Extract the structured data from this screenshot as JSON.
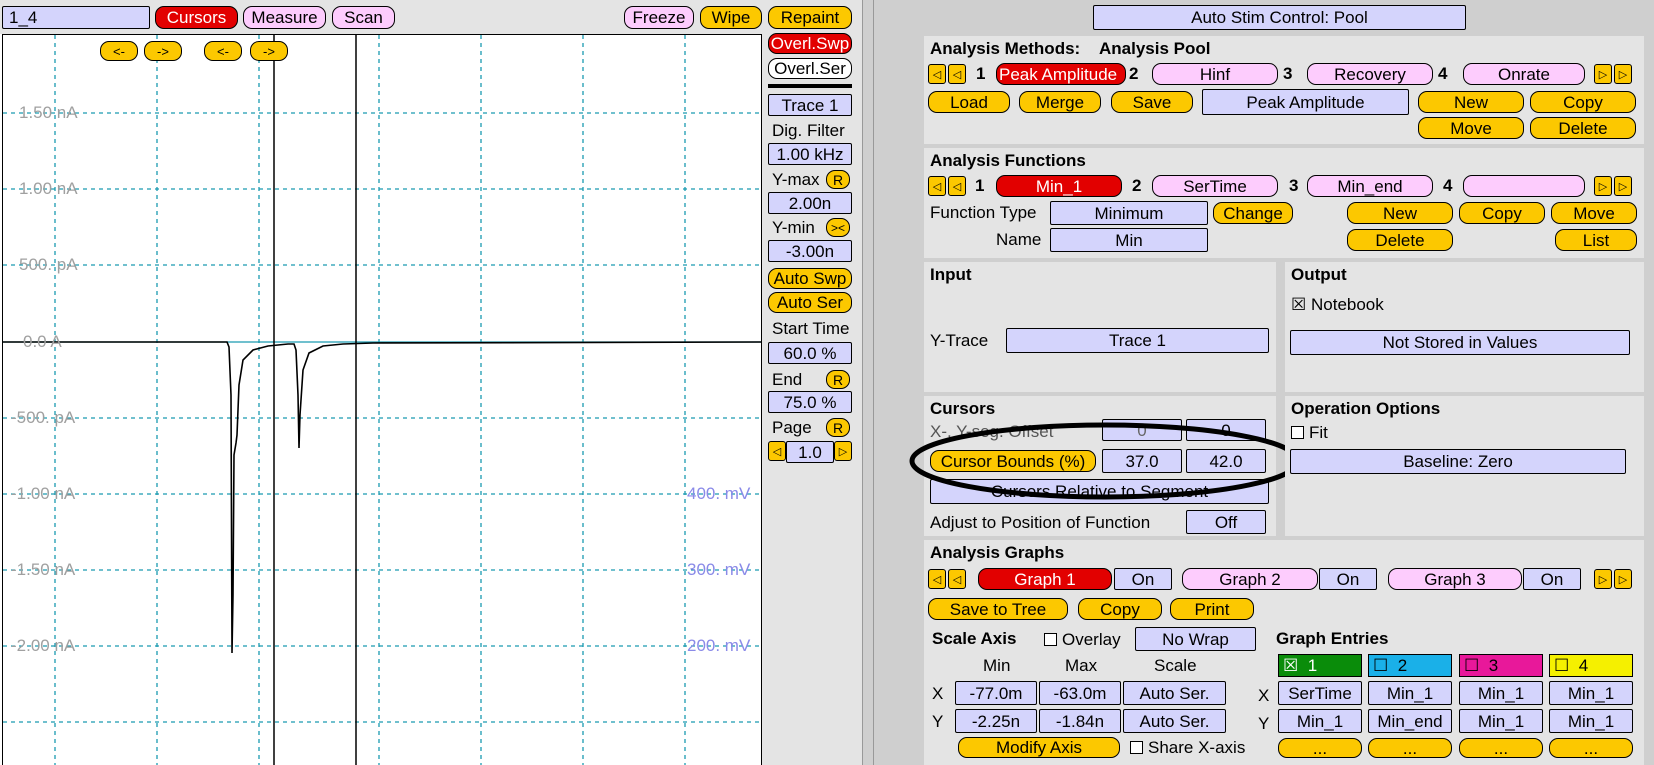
{
  "top": {
    "series_field": "1_4",
    "cursors": "Cursors",
    "measure": "Measure",
    "scan": "Scan",
    "freeze": "Freeze",
    "wipe": "Wipe",
    "repaint": "Repaint"
  },
  "scope": {
    "cursor_nav": [
      "<-",
      "->",
      "<-",
      "->"
    ],
    "y_labels": [
      "1.50 nA",
      "1.00 nA",
      "500. pA",
      "0.0 A",
      "-500. pA",
      "-1.00 nA",
      "-1.50 nA",
      "-2.00 nA"
    ],
    "v_labels": [
      "400. mV",
      "300. mV",
      "200. mV"
    ]
  },
  "sidebar": {
    "overl_swp": "Overl.Swp",
    "overl_ser": "Overl.Ser",
    "trace": "Trace 1",
    "dig_filter_label": "Dig. Filter",
    "dig_filter": "1.00 kHz",
    "ymax_label": "Y-max",
    "ymax": "2.00n",
    "r1": "R",
    "ymin_label": "Y-min",
    "ymin": "-3.00n",
    "swap_glyph": "><",
    "auto_swp": "Auto Swp",
    "auto_ser": "Auto Ser",
    "start_label": "Start Time",
    "start": "60.0 %",
    "end_label": "End",
    "end": "75.0 %",
    "r2": "R",
    "page_label": "Page",
    "page": "1.0",
    "r3": "R"
  },
  "right": {
    "auto_stim": "Auto Stim Control: Pool",
    "methods": {
      "title": "Analysis Methods:",
      "pool": "Analysis Pool",
      "items": [
        {
          "n": "1",
          "label": "Peak Amplitude"
        },
        {
          "n": "2",
          "label": "Hinf"
        },
        {
          "n": "3",
          "label": "Recovery"
        },
        {
          "n": "4",
          "label": "Onrate"
        }
      ],
      "load": "Load",
      "merge": "Merge",
      "save": "Save",
      "current": "Peak Amplitude",
      "new": "New",
      "copy": "Copy",
      "move": "Move",
      "delete": "Delete"
    },
    "functions": {
      "title": "Analysis Functions",
      "items": [
        {
          "n": "1",
          "label": "Min_1"
        },
        {
          "n": "2",
          "label": "SerTime"
        },
        {
          "n": "3",
          "label": "Min_end"
        },
        {
          "n": "4",
          "label": ""
        }
      ],
      "type_label": "Function Type",
      "type": "Minimum",
      "change": "Change",
      "name_label": "Name",
      "name": "Min",
      "new": "New",
      "copy": "Copy",
      "move": "Move",
      "delete": "Delete",
      "list": "List"
    },
    "input": {
      "title": "Input",
      "ytrace_label": "Y-Trace",
      "ytrace": "Trace 1"
    },
    "output": {
      "title": "Output",
      "check": "☒",
      "notebook": "Notebook",
      "stored": "Not Stored in Values"
    },
    "cursors": {
      "title": "Cursors",
      "offset_label": "X-, Y-seg. Offset",
      "offset_a": "0",
      "offset_b": "0",
      "bounds_label": "Cursor Bounds (%)",
      "bound_a": "37.0",
      "bound_b": "42.0",
      "relative": "Cursors Relative to Segment",
      "adjust_label": "Adjust to Position of Function",
      "adjust": "Off"
    },
    "operation": {
      "title": "Operation Options",
      "fit": "Fit",
      "baseline": "Baseline: Zero"
    },
    "graphs": {
      "title": "Analysis Graphs",
      "items": [
        {
          "label": "Graph 1",
          "state": "On"
        },
        {
          "label": "Graph 2",
          "state": "On"
        },
        {
          "label": "Graph 3",
          "state": "On"
        }
      ],
      "save_tree": "Save to Tree",
      "copy": "Copy",
      "print": "Print"
    },
    "scale": {
      "title": "Scale Axis",
      "overlay": "Overlay",
      "nowrap": "No Wrap",
      "h_min": "Min",
      "h_max": "Max",
      "h_scale": "Scale",
      "x_label": "X",
      "x_min": "-77.0m",
      "x_max": "-63.0m",
      "x_scale": "Auto Ser.",
      "y_label": "Y",
      "y_min": "-2.25n",
      "y_max": "-1.84n",
      "y_scale": "Auto Ser.",
      "modify": "Modify Axis",
      "share": "Share X-axis"
    },
    "entries": {
      "title": "Graph Entries",
      "heads": [
        {
          "check": "☒",
          "n": "1",
          "color": "#0a8c0a"
        },
        {
          "check": "☐",
          "n": "2",
          "color": "#1ab0e8"
        },
        {
          "check": "☐",
          "n": "3",
          "color": "#e8189a"
        },
        {
          "check": "☐",
          "n": "4",
          "color": "#f5f000"
        }
      ],
      "x_label": "X",
      "y_label": "Y",
      "x": [
        "SerTime",
        "Min_1",
        "Min_1",
        "Min_1"
      ],
      "y": [
        "Min_1",
        "Min_end",
        "Min_1",
        "Min_1"
      ],
      "more": [
        "...",
        "...",
        "...",
        "..."
      ]
    }
  }
}
